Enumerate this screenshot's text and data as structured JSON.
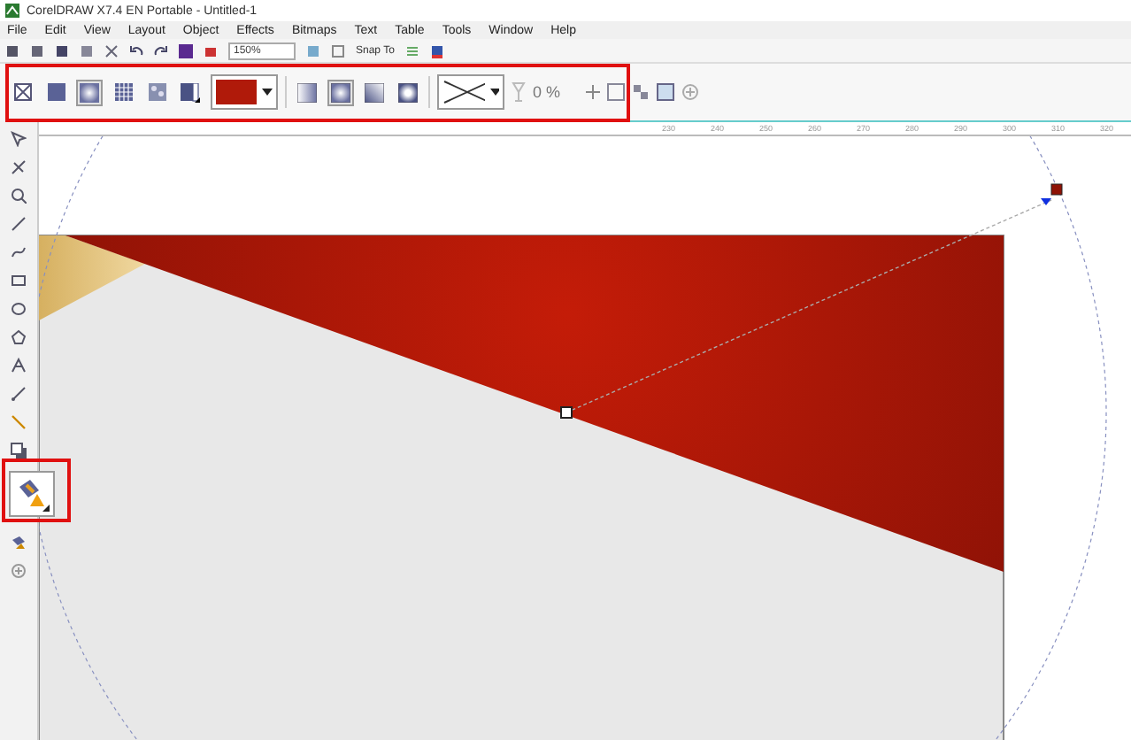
{
  "window": {
    "title": "CorelDRAW X7.4 EN Portable - Untitled-1"
  },
  "menu": [
    "File",
    "Edit",
    "View",
    "Layout",
    "Object",
    "Effects",
    "Bitmaps",
    "Text",
    "Table",
    "Tools",
    "Window",
    "Help"
  ],
  "standard_toolbar": {
    "zoom": "150%",
    "snap": "Snap To"
  },
  "property_bar": {
    "fill_types": [
      {
        "kind": "none",
        "selected": false
      },
      {
        "kind": "uniform",
        "selected": false
      },
      {
        "kind": "fountain",
        "selected": true
      },
      {
        "kind": "pattern",
        "selected": false
      },
      {
        "kind": "texture",
        "selected": false
      },
      {
        "kind": "postscript",
        "selected": false
      }
    ],
    "fountain_types": [
      {
        "kind": "linear",
        "selected": false
      },
      {
        "kind": "elliptical",
        "selected": true
      },
      {
        "kind": "conical",
        "selected": false
      },
      {
        "kind": "rectangular",
        "selected": false
      }
    ],
    "transparency": "0 %"
  },
  "ruler": {
    "labels": [
      "230",
      "240",
      "250",
      "260",
      "270",
      "280",
      "290",
      "300",
      "310",
      "320"
    ]
  },
  "toolbox": {
    "tools": [
      {
        "kind": "pick",
        "selected": false
      },
      {
        "kind": "shape",
        "selected": false
      },
      {
        "kind": "zoom",
        "selected": false
      },
      {
        "kind": "freehand",
        "selected": false
      },
      {
        "kind": "smart",
        "selected": false
      },
      {
        "kind": "rectangle",
        "selected": false
      },
      {
        "kind": "ellipse",
        "selected": false
      },
      {
        "kind": "polygon",
        "selected": false
      },
      {
        "kind": "text",
        "selected": false
      },
      {
        "kind": "dimension",
        "selected": false
      },
      {
        "kind": "connector",
        "selected": false
      },
      {
        "kind": "shadow",
        "selected": false
      },
      {
        "kind": "fill",
        "selected": true
      },
      {
        "kind": "smartfill",
        "selected": false
      },
      {
        "kind": "add",
        "selected": false
      }
    ]
  }
}
